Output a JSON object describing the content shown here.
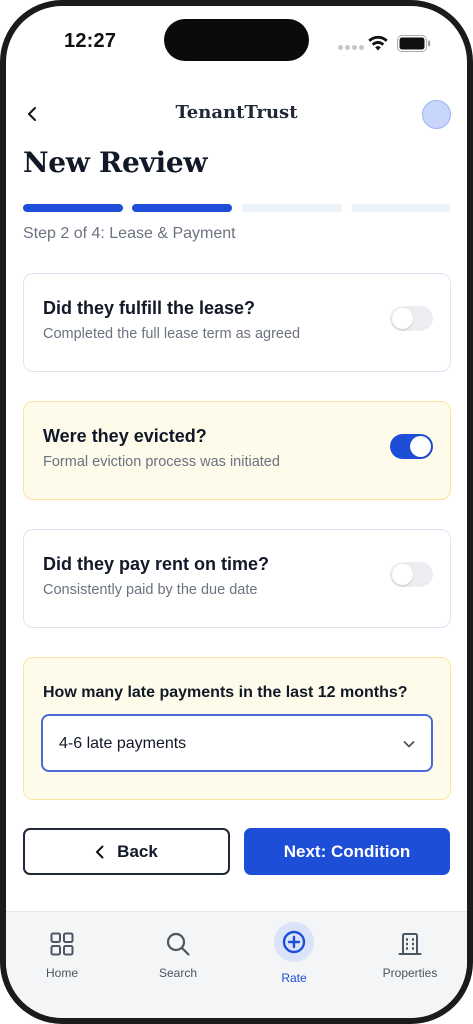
{
  "status_bar": {
    "time": "12:27"
  },
  "header": {
    "brand": "TenantTrust"
  },
  "page": {
    "title": "New Review",
    "step_label": "Step 2 of 4: Lease & Payment",
    "progress": {
      "current_step": 2,
      "total_steps": 4
    }
  },
  "questions": [
    {
      "question": "Did they fulfill the lease?",
      "subtitle": "Completed the full lease term as agreed",
      "toggle_on": false
    },
    {
      "question": "Were they evicted?",
      "subtitle": "Formal eviction process was initiated",
      "toggle_on": true
    },
    {
      "question": "Did they pay rent on time?",
      "subtitle": "Consistently paid by the due date",
      "toggle_on": false
    }
  ],
  "late_payments": {
    "label": "How many late payments in the last 12 months?",
    "selected": "4-6 late payments"
  },
  "actions": {
    "back_label": "Back",
    "next_label": "Next: Condition"
  },
  "tabbar": {
    "items": [
      {
        "label": "Home",
        "icon": "grid-icon"
      },
      {
        "label": "Search",
        "icon": "search-icon"
      },
      {
        "label": "Rate",
        "icon": "plus-circle-icon",
        "active": true
      },
      {
        "label": "Properties",
        "icon": "building-icon"
      }
    ]
  },
  "colors": {
    "accent": "#1d4ed8",
    "highlight_bg": "#fffbeb",
    "highlight_border": "#fbe3a0",
    "card_border": "#dbe6f3"
  }
}
